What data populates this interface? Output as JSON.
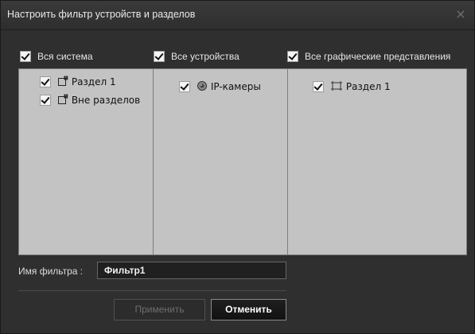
{
  "dialog": {
    "title": "Настроить фильтр устройств и разделов",
    "close_glyph": "×"
  },
  "columns": [
    {
      "header": "Вся система",
      "checked": true,
      "items": [
        {
          "label": "Раздел 1",
          "checked": true,
          "icon": "section-icon"
        },
        {
          "label": "Вне разделов",
          "checked": true,
          "icon": "section-icon"
        }
      ]
    },
    {
      "header": "Все устройства",
      "checked": true,
      "items": [
        {
          "label": "IP-камеры",
          "checked": true,
          "icon": "camera-icon"
        }
      ]
    },
    {
      "header": "Все графические представления",
      "checked": true,
      "items": [
        {
          "label": "Раздел 1",
          "checked": true,
          "icon": "map-icon"
        }
      ]
    }
  ],
  "filter": {
    "label": "Имя фильтра :",
    "value": "Фильтр1"
  },
  "buttons": {
    "apply": "Применить",
    "cancel": "Отменить"
  },
  "colors": {
    "background": "#2f2f2f",
    "panel": "#c3c3c3",
    "text": "#e6e6e6"
  }
}
